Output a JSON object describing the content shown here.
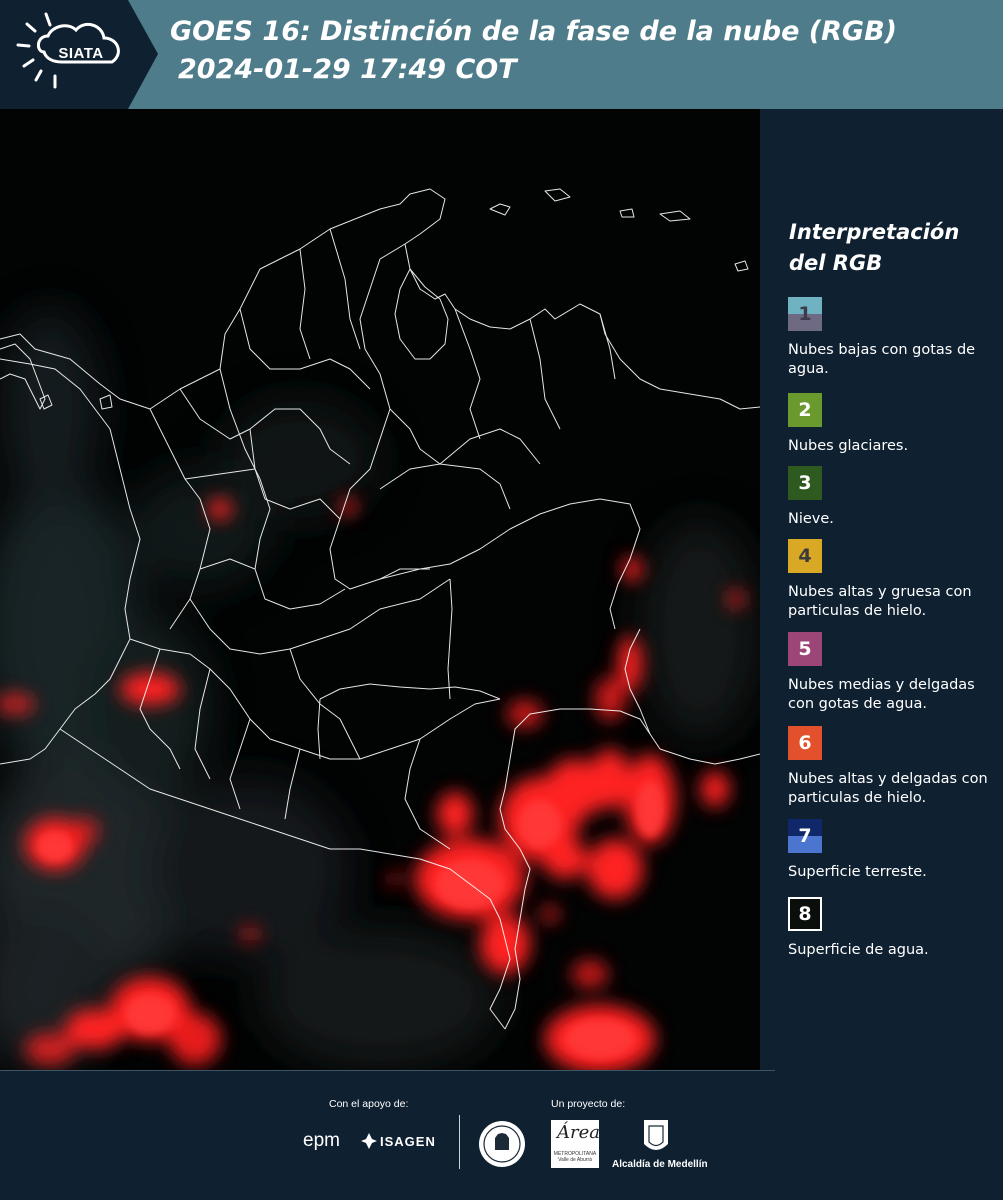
{
  "header": {
    "logo_text": "SIATA",
    "title_line1": "GOES 16: Distinción de la fase de la nube (RGB)",
    "title_line2": "2024-01-29 17:49 COT",
    "background_color": "#4f7c8a"
  },
  "legend": {
    "title_line1": "Interpretación",
    "title_line2": "del RGB",
    "items": [
      {
        "number": "1",
        "label": "Nubes bajas con gotas de agua.",
        "colors": [
          "#6fb3c3",
          "#6e6a83"
        ],
        "text_color": "#3b3b4a"
      },
      {
        "number": "2",
        "label": "Nubes glaciares.",
        "colors": [
          "#6a9a2e"
        ],
        "text_color": "#ffffff"
      },
      {
        "number": "3",
        "label": "Nieve.",
        "colors": [
          "#2f5a1f"
        ],
        "text_color": "#ffffff"
      },
      {
        "number": "4",
        "label": "Nubes altas y gruesa con particulas de hielo.",
        "colors": [
          "#d9a926"
        ],
        "text_color": "#3b3b3b"
      },
      {
        "number": "5",
        "label": "Nubes medias y delgadas con gotas de agua.",
        "colors": [
          "#9b4676"
        ],
        "text_color": "#ffffff"
      },
      {
        "number": "6",
        "label": "Nubes altas y delgadas con particulas de hielo.",
        "colors": [
          "#e2512c"
        ],
        "text_color": "#ffffff"
      },
      {
        "number": "7",
        "label": "Superficie terreste.",
        "colors": [
          "#10276a",
          "#4b75cf"
        ],
        "text_color": "#ffffff"
      },
      {
        "number": "8",
        "label": "Superficie de agua.",
        "colors": [
          "#0b0f0c"
        ],
        "text_color": "#ffffff"
      }
    ]
  },
  "footer": {
    "support_label": "Con el apoyo de:",
    "project_label": "Un proyecto de:",
    "sponsors": [
      "epm",
      "ISAGEN"
    ],
    "partners": [
      "Área Metropolitana Valle de Aburrá",
      "Alcaldía de Medellín"
    ],
    "area_word": "Área",
    "area_subtitle": "METROPOLITANA Valle de Aburrá",
    "alcaldia_label": "Alcaldía de Medellín"
  },
  "map": {
    "cloud_color": "#ff1f1f",
    "boundary_color": "#ffffff"
  }
}
